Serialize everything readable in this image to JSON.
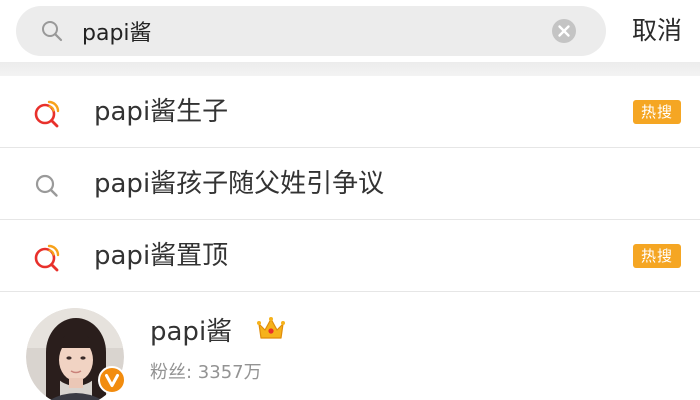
{
  "search": {
    "query": "papi酱",
    "cancel_label": "取消"
  },
  "suggestions": [
    {
      "text": "papi酱生子",
      "icon": "hot-search-icon",
      "badge": "热搜"
    },
    {
      "text": "papi酱孩子随父姓引争议",
      "icon": "search-icon",
      "badge": null
    },
    {
      "text": "papi酱置顶",
      "icon": "hot-search-icon",
      "badge": "热搜"
    }
  ],
  "user": {
    "name": "papi酱",
    "followers": "粉丝: 3357万",
    "icons": [
      "avatar",
      "verified-badge-icon",
      "crown-icon"
    ]
  },
  "colors": {
    "badge": "#f5a623",
    "hot_icon_red": "#e8302b",
    "hot_icon_orange": "#f7a21b",
    "verified": "#f28c0f",
    "crown": "#f6b21b",
    "field_bg": "#ececec"
  }
}
